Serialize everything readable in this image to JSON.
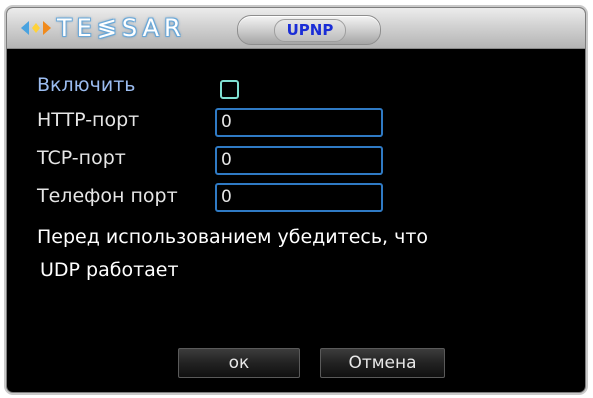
{
  "header": {
    "logo_text": "TE≶SAR",
    "title": "UPNP"
  },
  "form": {
    "enable_label": "Включить",
    "enable_checked": false,
    "http_label": "HTTP-порт",
    "http_value": "0",
    "tcp_label": "TCP-порт",
    "tcp_value": "0",
    "phone_label": "Телефон порт",
    "phone_value": "0"
  },
  "note": {
    "line1": "Перед использованием убедитесь, что",
    "line2": "UDP работает"
  },
  "buttons": {
    "ok_label": "ок",
    "cancel_label": "Отмена"
  },
  "colors": {
    "enable_label": "#9bbcf0",
    "checkbox_border": "#7fe0d2",
    "field_border": "#2f7ac4",
    "title_text": "#1a2dd6"
  }
}
